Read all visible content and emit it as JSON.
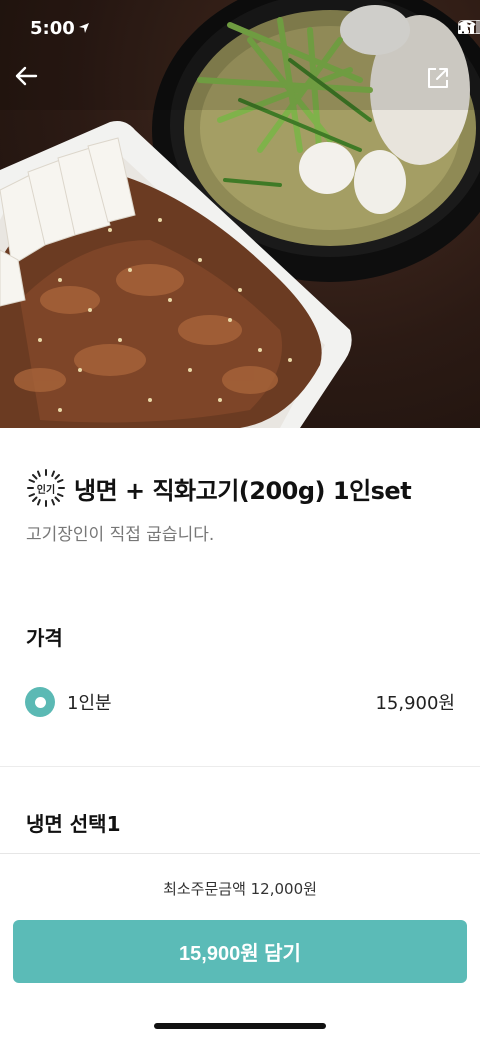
{
  "status": {
    "time": "5:00"
  },
  "product": {
    "badge": "인기",
    "title": "냉면 + 직화고기(200g) 1인set",
    "subtitle": "고기장인이 직접 굽습니다."
  },
  "price_section": {
    "heading": "가격",
    "options": [
      {
        "label": "1인분",
        "price": "15,900원",
        "selected": true
      }
    ]
  },
  "noodle_section": {
    "heading": "냉면 선택1"
  },
  "footer": {
    "min_order": "최소주문금액 12,000원",
    "cart_button": "15,900원 담기"
  },
  "colors": {
    "accent": "#5bbbb7",
    "radio": "#5bb9b4"
  },
  "icons": {
    "back": "arrow-left-icon",
    "share": "share-icon"
  }
}
